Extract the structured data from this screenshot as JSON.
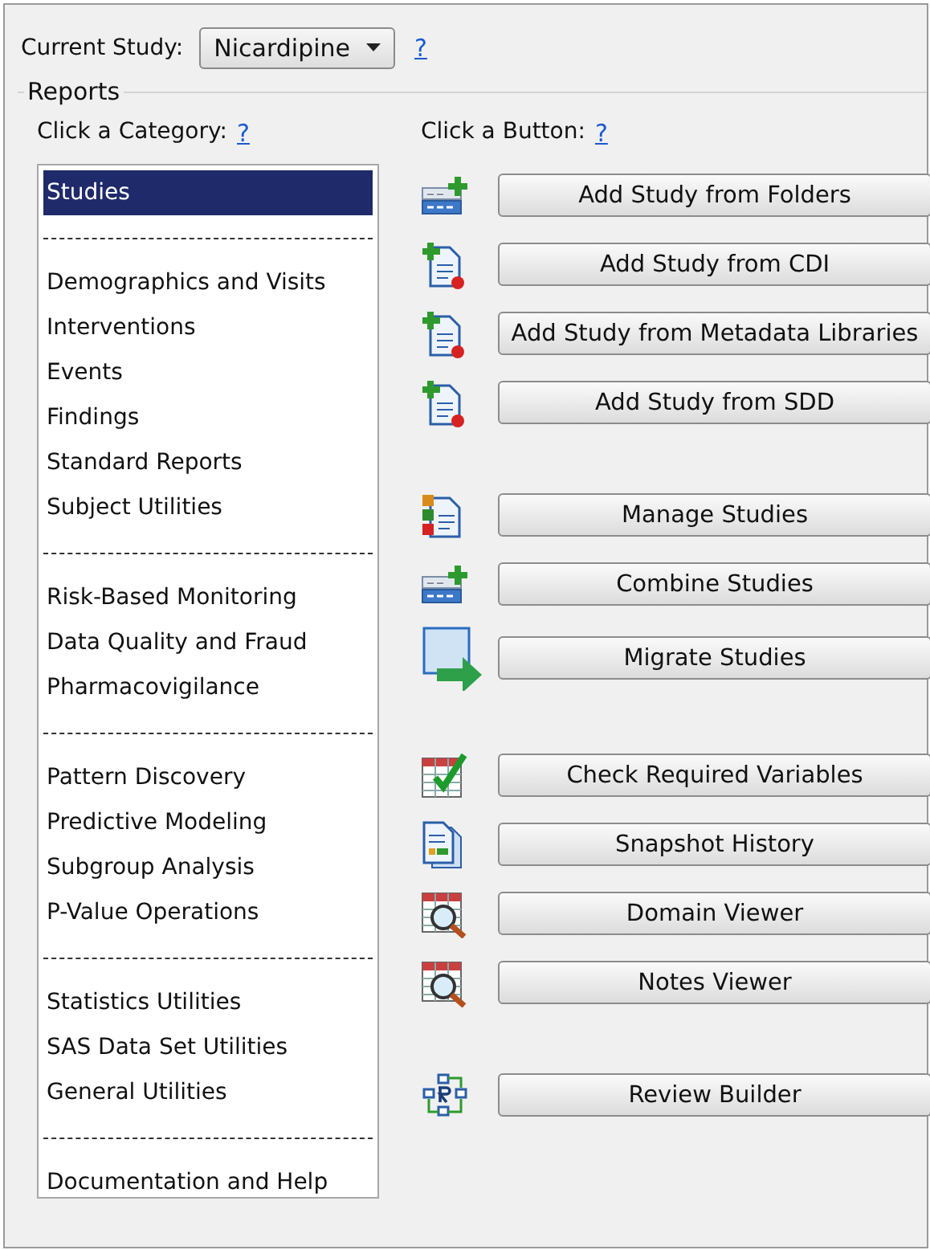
{
  "current_study": {
    "label": "Current Study:",
    "value": "Nicardipine",
    "help": "?"
  },
  "reports": {
    "title": "Reports",
    "category_heading": {
      "label": "Click a Category:",
      "help": "?"
    },
    "button_heading": {
      "label": "Click a Button:",
      "help": "?"
    },
    "categories": [
      {
        "kind": "item",
        "label": "Studies",
        "selected": true
      },
      {
        "kind": "separator"
      },
      {
        "kind": "item",
        "label": "Demographics and Visits",
        "selected": false
      },
      {
        "kind": "item",
        "label": "Interventions",
        "selected": false
      },
      {
        "kind": "item",
        "label": "Events",
        "selected": false
      },
      {
        "kind": "item",
        "label": "Findings",
        "selected": false
      },
      {
        "kind": "item",
        "label": "Standard Reports",
        "selected": false
      },
      {
        "kind": "item",
        "label": "Subject Utilities",
        "selected": false
      },
      {
        "kind": "separator"
      },
      {
        "kind": "item",
        "label": "Risk-Based Monitoring",
        "selected": false
      },
      {
        "kind": "item",
        "label": "Data Quality and Fraud",
        "selected": false
      },
      {
        "kind": "item",
        "label": "Pharmacovigilance",
        "selected": false
      },
      {
        "kind": "separator"
      },
      {
        "kind": "item",
        "label": "Pattern Discovery",
        "selected": false
      },
      {
        "kind": "item",
        "label": "Predictive Modeling",
        "selected": false
      },
      {
        "kind": "item",
        "label": "Subgroup Analysis",
        "selected": false
      },
      {
        "kind": "item",
        "label": "P-Value Operations",
        "selected": false
      },
      {
        "kind": "separator"
      },
      {
        "kind": "item",
        "label": "Statistics Utilities",
        "selected": false
      },
      {
        "kind": "item",
        "label": "SAS Data Set Utilities",
        "selected": false
      },
      {
        "kind": "item",
        "label": "General Utilities",
        "selected": false
      },
      {
        "kind": "separator"
      },
      {
        "kind": "item",
        "label": "Documentation and Help",
        "selected": false
      }
    ],
    "button_groups": [
      [
        "Add Study from Folders",
        "Add Study from CDI",
        "Add Study from Metadata Libraries",
        "Add Study from SDD"
      ],
      [
        "Manage Studies",
        "Combine Studies",
        "Migrate Studies"
      ],
      [
        "Check Required Variables",
        "Snapshot History",
        "Domain Viewer",
        "Notes Viewer"
      ],
      [
        "Review Builder"
      ]
    ]
  }
}
